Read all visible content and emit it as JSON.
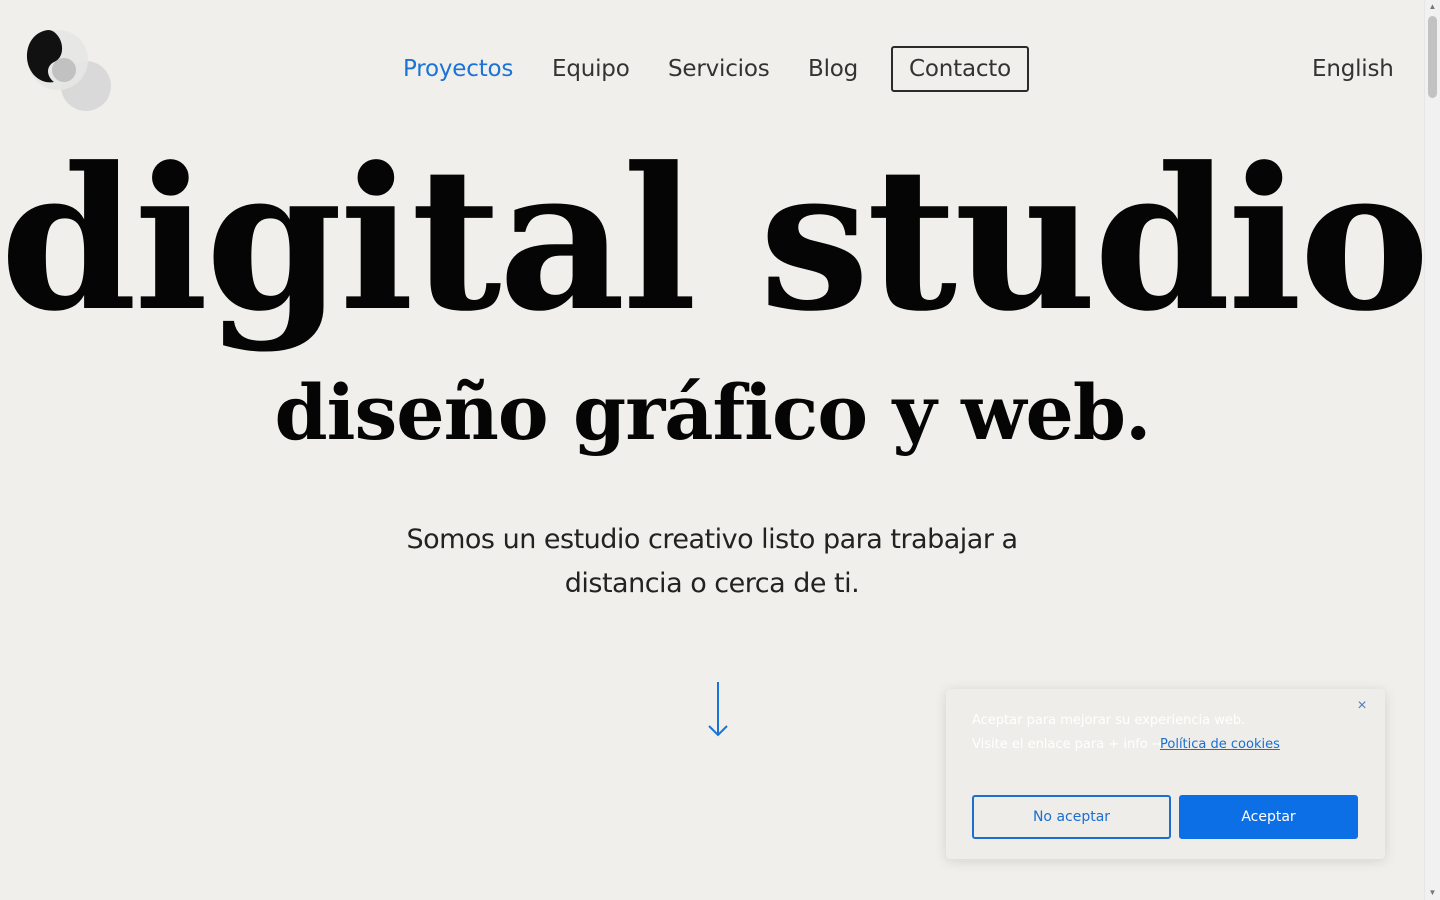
{
  "logo": {
    "icon": "studio-logo-icon"
  },
  "nav": {
    "items": [
      {
        "label": "Proyectos",
        "active": true
      },
      {
        "label": "Equipo",
        "active": false
      },
      {
        "label": "Servicios",
        "active": false
      },
      {
        "label": "Blog",
        "active": false
      }
    ],
    "contact_label": "Contacto",
    "language_label": "English"
  },
  "hero": {
    "title": "digital studio.",
    "subtitle": "diseño gráfico y web.",
    "description_line1": "Somos un estudio creativo listo para trabajar a",
    "description_line2": "distancia o cerca de ti.",
    "arrow_icon": "arrow-down-icon"
  },
  "cookie_banner": {
    "text_line1": "Aceptar para mejorar su experiencia web.",
    "text_line2": "Visite el enlace para + info →",
    "policy_link": "Política de cookies",
    "close_icon": "×",
    "reject_label": "No aceptar",
    "accept_label": "Aceptar"
  },
  "colors": {
    "background": "#f0efeb",
    "accent": "#1a73d6",
    "text": "#050505",
    "button_primary": "#0d6fe6"
  }
}
